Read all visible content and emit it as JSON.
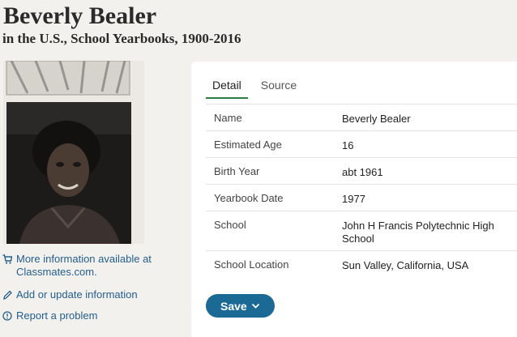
{
  "header": {
    "name": "Beverly Bealer",
    "collection": "in the U.S., School Yearbooks, 1900-2016"
  },
  "sidebar": {
    "more_info_line1": "More information available at",
    "more_info_line2": "Classmates.com.",
    "add_update": "Add or update information",
    "report": "Report a problem"
  },
  "tabs": [
    "Detail",
    "Source"
  ],
  "details": [
    {
      "label": "Name",
      "value": "Beverly Bealer"
    },
    {
      "label": "Estimated Age",
      "value": "16"
    },
    {
      "label": "Birth Year",
      "value": "abt 1961"
    },
    {
      "label": "Yearbook Date",
      "value": "1977"
    },
    {
      "label": "School",
      "value": "John H Francis Polytechnic High School"
    },
    {
      "label": "School Location",
      "value": "Sun Valley, California, USA"
    }
  ],
  "save_button": {
    "label": "Save"
  },
  "icons": {
    "cart": "cart-icon",
    "pencil": "pencil-icon",
    "alert": "alert-circle-icon",
    "chevron": "chevron-down-icon"
  },
  "colors": {
    "link": "#245e8f",
    "button": "#1b6a95",
    "tab_underline": "#2f7d42"
  }
}
